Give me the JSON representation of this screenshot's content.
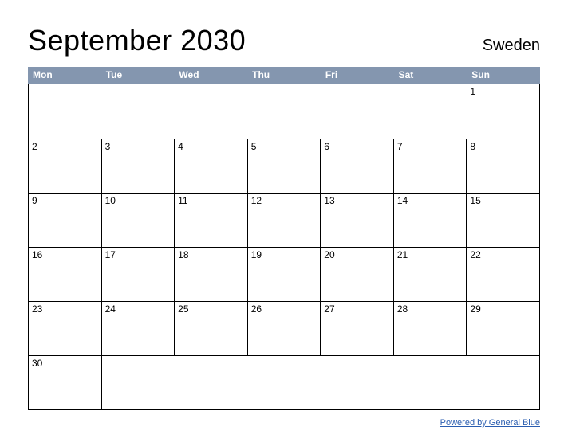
{
  "header": {
    "title": "September 2030",
    "country": "Sweden"
  },
  "dayHeaders": [
    "Mon",
    "Tue",
    "Wed",
    "Thu",
    "Fri",
    "Sat",
    "Sun"
  ],
  "weeks": [
    [
      "",
      "",
      "",
      "",
      "",
      "",
      "1"
    ],
    [
      "2",
      "3",
      "4",
      "5",
      "6",
      "7",
      "8"
    ],
    [
      "9",
      "10",
      "11",
      "12",
      "13",
      "14",
      "15"
    ],
    [
      "16",
      "17",
      "18",
      "19",
      "20",
      "21",
      "22"
    ],
    [
      "23",
      "24",
      "25",
      "26",
      "27",
      "28",
      "29"
    ],
    [
      "30",
      "",
      "",
      "",
      "",
      "",
      ""
    ]
  ],
  "footer": {
    "linkText": "Powered by General Blue"
  }
}
